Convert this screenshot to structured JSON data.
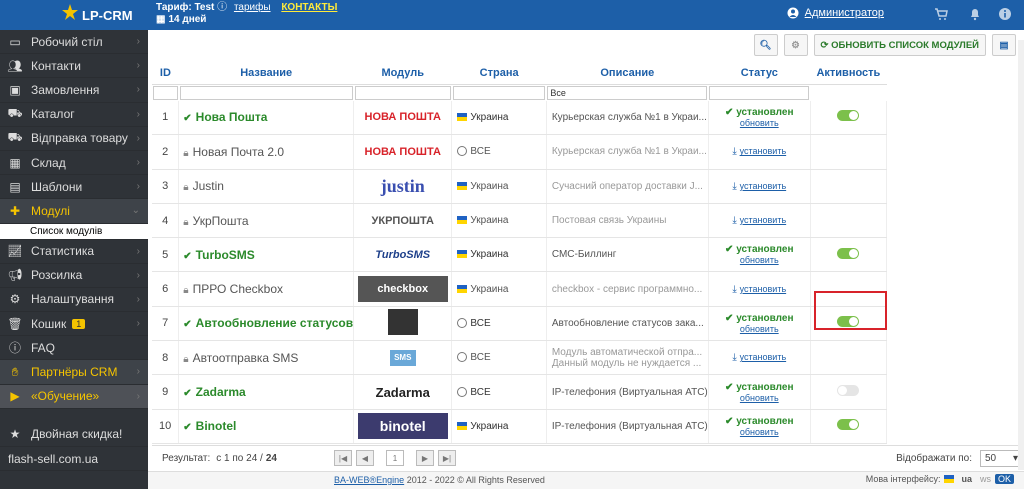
{
  "app": {
    "title": "LP-CRM"
  },
  "top": {
    "tariff_label": "Тариф:",
    "tariff_name": "Test",
    "tariffs_link": "тарифы",
    "contacts_link": "КОНТАКТЫ",
    "days": "14 дней",
    "user": "Администратор"
  },
  "sidebar": {
    "items": [
      {
        "label": "Робочий стіл",
        "icon": "desktop-icon"
      },
      {
        "label": "Контакти",
        "icon": "users-icon"
      },
      {
        "label": "Замовлення",
        "icon": "orders-icon"
      },
      {
        "label": "Каталог",
        "icon": "truck-icon"
      },
      {
        "label": "Відправка товару",
        "icon": "truck-icon"
      },
      {
        "label": "Склад",
        "icon": "warehouse-icon"
      },
      {
        "label": "Шаблони",
        "icon": "template-icon"
      },
      {
        "label": "Модулі",
        "icon": "puzzle-icon"
      },
      {
        "label": "Список модулів",
        "icon": ""
      },
      {
        "label": "Статистика",
        "icon": "chart-icon"
      },
      {
        "label": "Розсилка",
        "icon": "megaphone-icon"
      },
      {
        "label": "Налаштування",
        "icon": "gear-icon"
      },
      {
        "label": "Кошик",
        "icon": "trash-icon",
        "badge": "1"
      },
      {
        "label": "FAQ",
        "icon": "info-icon"
      },
      {
        "label": "Партнёры CRM",
        "icon": "handshake-icon"
      },
      {
        "label": "«Обучение»",
        "icon": "video-icon"
      },
      {
        "label": "Двойная скидка!",
        "icon": "star-icon"
      },
      {
        "label": "flash-sell.com.ua",
        "icon": ""
      }
    ]
  },
  "toolbar": {
    "update_label": "ОБНОВИТЬ СПИСОК МОДУЛЕЙ"
  },
  "table": {
    "headers": {
      "id": "ID",
      "name": "Название",
      "module": "Модуль",
      "country": "Страна",
      "desc": "Описание",
      "status": "Статус",
      "active": "Активность"
    },
    "filter_desc": "Все",
    "rows": [
      {
        "id": "1",
        "name": "Нова Пошта",
        "logo": "НОВА ПОШТА",
        "country": "Украина",
        "desc": "Курьерская служба №1 в Украи...",
        "installed": true,
        "active": true
      },
      {
        "id": "2",
        "name": "Новая Почта 2.0",
        "logo": "НОВА ПОШТА",
        "country": "ВСЕ",
        "desc": "Курьерская служба №1 в Украи...",
        "installed": false
      },
      {
        "id": "3",
        "name": "Justin",
        "logo": "justin",
        "country": "Украина",
        "desc": "Сучасний оператор доставки J...",
        "installed": false
      },
      {
        "id": "4",
        "name": "УкрПошта",
        "logo": "УКРПОШТА",
        "country": "Украина",
        "desc": "Постовая связь Украины",
        "installed": false
      },
      {
        "id": "5",
        "name": "TurboSMS",
        "logo": "TurboSMS",
        "country": "Украина",
        "desc": "СМС-Биллинг",
        "installed": true,
        "active": true
      },
      {
        "id": "6",
        "name": "ПРРО Checkbox",
        "logo": "checkbox",
        "country": "Украина",
        "desc": "checkbox - сервис программно...",
        "installed": false
      },
      {
        "id": "7",
        "name": "Автообновление статусов",
        "logo": "",
        "country": "ВСЕ",
        "desc": "Автообновление статусов зака...",
        "installed": true,
        "active": true
      },
      {
        "id": "8",
        "name": "Автоотправка SMS",
        "logo": "SMS",
        "country": "ВСЕ",
        "desc": "Модуль автоматической отпра...",
        "desc2": "Данный модуль не нуждается ...",
        "installed": false
      },
      {
        "id": "9",
        "name": "Zadarma",
        "logo": "Zadarma",
        "country": "ВСЕ",
        "desc": "IP-телефония (Виртуальная АТС)",
        "installed": true,
        "active": false
      },
      {
        "id": "10",
        "name": "Binotel",
        "logo": "binotel",
        "country": "Украина",
        "desc": "IP-телефония (Виртуальная АТС)",
        "installed": true,
        "active": true
      }
    ],
    "status_installed": "установлен",
    "status_update": "обновить",
    "status_install": "установить"
  },
  "pager": {
    "result_label": "Результат:",
    "range": "с 1 по 24 /",
    "total": "24",
    "page": "1",
    "per_page_label": "Відображати по:",
    "per_page": "50"
  },
  "footer": {
    "brand": "BA-WEB®Engine",
    "copy": "2012 - 2022 © All Rights Reserved",
    "lang_label": "Мова інтерфейсу:",
    "lang": "ua",
    "ws": "ws",
    "ok": "OK"
  },
  "colors": {
    "brand": "#1d5fa8",
    "sidebar": "#2f3338",
    "accent": "#f5c400",
    "ok": "#2b8a2b",
    "highlight": "#d8232a"
  }
}
